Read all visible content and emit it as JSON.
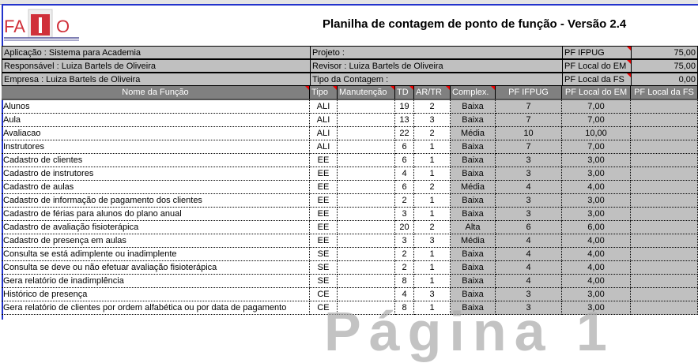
{
  "logo": {
    "text": "FATTO"
  },
  "title": "Planilha de contagem de ponto de função - Versão 2.4",
  "info": {
    "aplicacao": "Aplicação : Sistema para Academia",
    "responsavel": "Responsável : Luiza Bartels de Oliveira",
    "empresa": "Empresa : Luiza Bartels de Oliveira",
    "projeto": "Projeto :",
    "revisor": "Revisor : Luiza Bartels de Oliveira",
    "tipo_contagem": "Tipo da Contagem :",
    "pf_ifpug_label": "PF IFPUG",
    "pf_ifpug": "75,00",
    "pf_em_label": "PF Local do EM",
    "pf_em": "75,00",
    "pf_fs_label": "PF Local da FS",
    "pf_fs": "0,00"
  },
  "columns": [
    "Nome da Função",
    "Tipo",
    "Manutenção",
    "TD",
    "AR/TR",
    "Complex.",
    "PF IFPUG",
    "PF Local do EM",
    "PF Local da FS"
  ],
  "rows": [
    [
      "Alunos",
      "ALI",
      "",
      "19",
      "2",
      "Baixa",
      "7",
      "7,00",
      ""
    ],
    [
      "Aula",
      "ALI",
      "",
      "13",
      "3",
      "Baixa",
      "7",
      "7,00",
      ""
    ],
    [
      "Avaliacao",
      "ALI",
      "",
      "22",
      "2",
      "Média",
      "10",
      "10,00",
      ""
    ],
    [
      "Instrutores",
      "ALI",
      "",
      "6",
      "1",
      "Baixa",
      "7",
      "7,00",
      ""
    ],
    [
      "Cadastro de clientes",
      "EE",
      "",
      "6",
      "1",
      "Baixa",
      "3",
      "3,00",
      ""
    ],
    [
      "Cadastro de instrutores",
      "EE",
      "",
      "4",
      "1",
      "Baixa",
      "3",
      "3,00",
      ""
    ],
    [
      "Cadastro de aulas",
      "EE",
      "",
      "6",
      "2",
      "Média",
      "4",
      "4,00",
      ""
    ],
    [
      "Cadastro de informação de pagamento dos clientes",
      "EE",
      "",
      "2",
      "1",
      "Baixa",
      "3",
      "3,00",
      ""
    ],
    [
      "Cadastro de férias para alunos do plano anual",
      "EE",
      "",
      "3",
      "1",
      "Baixa",
      "3",
      "3,00",
      ""
    ],
    [
      "Cadastro de avaliação fisioterápica",
      "EE",
      "",
      "20",
      "2",
      "Alta",
      "6",
      "6,00",
      ""
    ],
    [
      "Cadastro de presença em aulas",
      "EE",
      "",
      "3",
      "3",
      "Média",
      "4",
      "4,00",
      ""
    ],
    [
      "Consulta se está adimplente ou inadimplente",
      "SE",
      "",
      "2",
      "1",
      "Baixa",
      "4",
      "4,00",
      ""
    ],
    [
      "Consulta se deve ou não efetuar avaliação fisioterápica",
      "SE",
      "",
      "2",
      "1",
      "Baixa",
      "4",
      "4,00",
      ""
    ],
    [
      "Gera relatório de inadimplência",
      "SE",
      "",
      "8",
      "1",
      "Baixa",
      "4",
      "4,00",
      ""
    ],
    [
      "Histórico de presença",
      "CE",
      "",
      "4",
      "3",
      "Baixa",
      "3",
      "3,00",
      ""
    ],
    [
      "Gera relatório de clientes por ordem alfabética ou por data de pagamento",
      "CE",
      "",
      "8",
      "1",
      "Baixa",
      "3",
      "3,00",
      ""
    ]
  ],
  "watermark": "Página 1"
}
